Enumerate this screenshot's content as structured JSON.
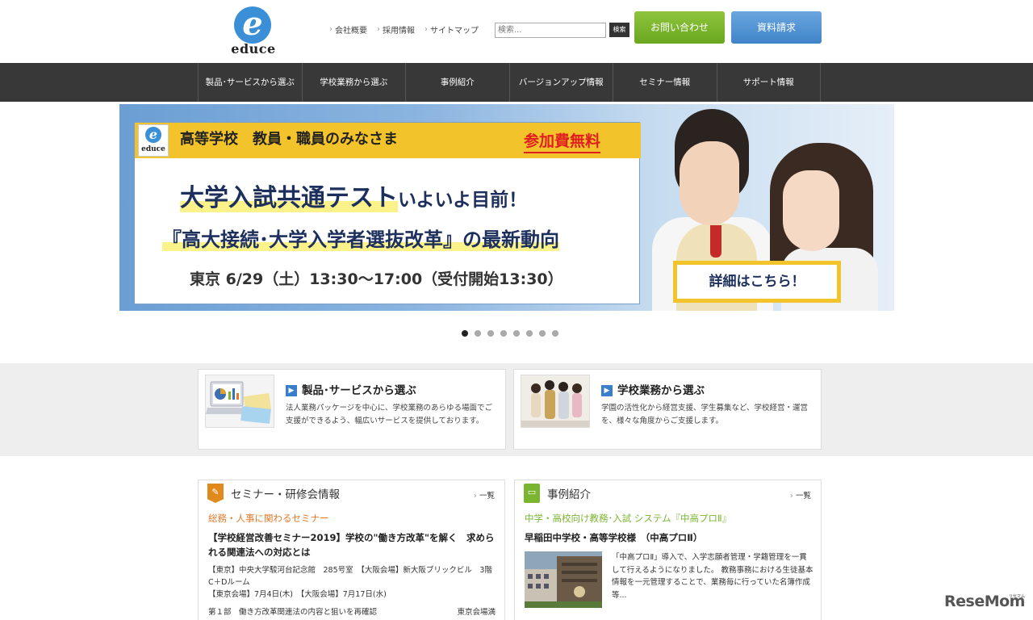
{
  "header": {
    "logo_mark": "e",
    "logo_word": "educe",
    "toplinks": [
      "会社概要",
      "採用情報",
      "サイトマップ"
    ],
    "search_placeholder": "検索...",
    "search_button": "検索",
    "contact_button": "お問い合わせ",
    "docs_button": "資料請求"
  },
  "nav": {
    "items": [
      "製品･サービスから選ぶ",
      "学校業務から選ぶ",
      "事例紹介",
      "バージョンアップ情報",
      "セミナー情報",
      "サポート情報"
    ]
  },
  "banner": {
    "logo_mark": "e",
    "logo_word": "educe",
    "audience": "高等学校　教員・職員のみなさま",
    "free": "参加費無料",
    "headline_main": "大学入試共通テスト",
    "headline_tail": "いよいよ目前！",
    "subhead": "『高大接続･大学入学者選抜改革』の最新動向",
    "date": "東京 6/29（土）13:30～17:00（受付開始13:30）",
    "detail_button": "詳細はこちら！"
  },
  "slider": {
    "total": 8,
    "active": 1
  },
  "categories": [
    {
      "title": "製品･サービスから選ぶ",
      "desc": "法人業務パッケージを中心に、学校業務のあらゆる場面でご支援ができるよう、幅広いサービスを提供しております。"
    },
    {
      "title": "学校業務から選ぶ",
      "desc": "学園の活性化から経営支援、学生募集など、学校経営・運営を、様々な角度からご支援します。"
    }
  ],
  "seminar": {
    "title": "セミナー・研修会情報",
    "more": "一覧",
    "category": "総務・人事に関わるセミナー",
    "headline": "【学校経営改善セミナー2019】学校の\"働き方改革\"を解く　求められる関連法への対応とは",
    "venue": "【東京】中央大学駿河台記念館　285号室　【大阪会場】新大阪ブリックビル　3階　C＋Dルーム",
    "dates": "【東京会場】7月4日(木)　【大阪会場】7月17日(水)",
    "extra_left": "第１部　働き方改革関連法の内容と狙いを再確認",
    "extra_right": "東京会場満"
  },
  "cases": {
    "title": "事例紹介",
    "more": "一覧",
    "category": "中学・高校向け教務･入試 システム『中高プロⅡ』",
    "headline": "早稲田中学校・高等学校様　（中高プロⅡ）",
    "desc": "「中高プロⅡ」導入で、入学志願者管理・学籍管理を一貫して行えるようになりました。 教務事務における生徒基本情報を一元管理することで、業務毎に行っていた名簿作成等..."
  },
  "watermark": {
    "text": "ReseMom",
    "small": "リセマム"
  },
  "colors": {
    "nav_bg": "#383838",
    "contact_green": "#7ab530",
    "docs_blue": "#4f90d2",
    "accent_orange": "#e07a2a",
    "accent_green": "#7ab530",
    "banner_yellow": "#f2c32a",
    "free_red": "#e02020"
  }
}
